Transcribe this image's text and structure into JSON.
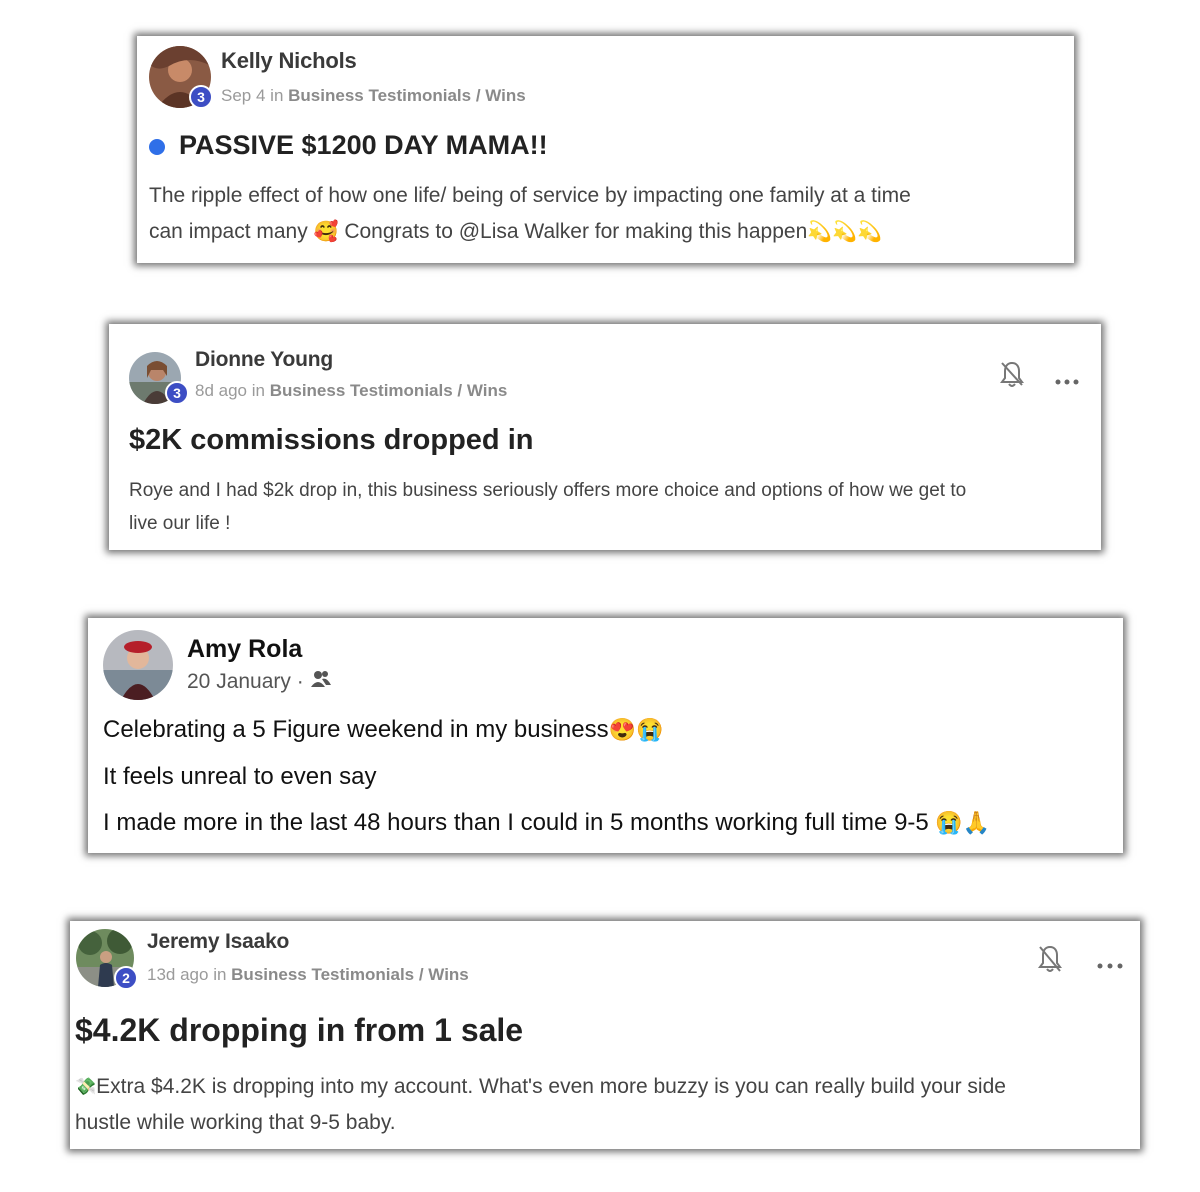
{
  "posts": [
    {
      "author": "Kelly Nichols",
      "level": "3",
      "date": "Sep 4",
      "in_word": "in",
      "category": "Business Testimonials / Wins",
      "title": "PASSIVE $1200 DAY MAMA!!",
      "line1": "The ripple effect of how one life/ being of service by impacting one family at a time",
      "line2_a": "can impact many",
      "line2_emoji": "🥰",
      "line2_b": "Congrats to @Lisa Walker for making this happen",
      "line2_tail": "💫💫💫"
    },
    {
      "author": "Dionne Young",
      "level": "3",
      "date": "8d ago",
      "in_word": "in",
      "category": "Business Testimonials / Wins",
      "title": "$2K commissions dropped in",
      "line1": "Roye and I had $2k drop in, this business seriously offers more choice and options of how we get to",
      "line2": "live our life !"
    },
    {
      "author": "Amy Rola",
      "date": "20 January · ",
      "line1": "Celebrating a 5 Figure weekend in my business",
      "line1_emoji": "😍😭",
      "line2": "It feels unreal to even say",
      "line3": "I made more in the last 48 hours than I could in 5 months working full time 9-5",
      "line3_emoji": "😭🙏"
    },
    {
      "author": "Jeremy Isaako",
      "level": "2",
      "date": "13d ago",
      "in_word": "in",
      "category": "Business Testimonials / Wins",
      "title": "$4.2K dropping in from 1 sale",
      "line1_emoji": "💸",
      "line1": "Extra $4.2K is dropping into my account. What's even more buzzy is you can really build your side",
      "line2": "hustle while working that 9-5 baby."
    }
  ],
  "icons": {
    "bell": "bell-off-icon",
    "more": "more-horizontal-icon",
    "friends": "friends-icon"
  },
  "colors": {
    "badge": "#3d4ec4",
    "unread_dot": "#2f6fe8"
  }
}
